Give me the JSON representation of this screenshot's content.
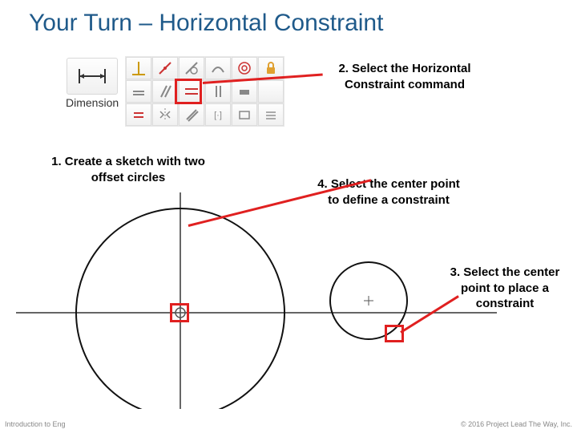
{
  "title": "Your Turn – Horizontal Constraint",
  "dimension_label": "Dimension",
  "instructions": {
    "i1": "1. Create a sketch with two offset circles",
    "i2": "2. Select the Horizontal Constraint command",
    "i3": "3. Select the center point to place a constraint",
    "i4": "4. Select the center point to define a constraint"
  },
  "footer": {
    "left": "Introduction to Eng",
    "right": "© 2016 Project Lead The Way, Inc."
  },
  "toolbar_cells": {
    "r0c0": "perpendicular-icon",
    "r0c1": "coincident-icon",
    "r0c2": "tangent-icon",
    "r0c3": "smooth-icon",
    "r0c4": "concentric-icon",
    "r0c5": "lock-icon",
    "r1c0": "colinear-icon",
    "r1c1": "parallel-icon",
    "r1c2": "horizontal-icon",
    "r1c3": "vertical-icon",
    "r1c4": "fix-icon",
    "r1c5": "blank-icon",
    "r2c0": "equal-icon",
    "r2c1": "mirror-icon",
    "r2c2": "pattern-icon",
    "r2c3": "symmetric-icon",
    "r2c4": "dimension-set-icon",
    "r2c5": "settings-icon"
  }
}
